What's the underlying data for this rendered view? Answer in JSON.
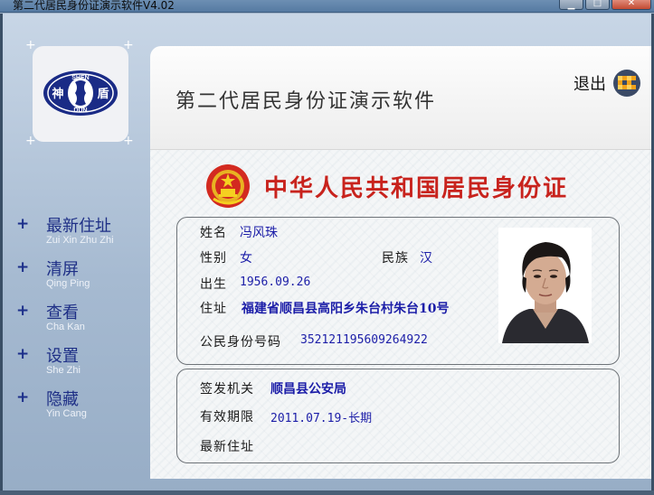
{
  "window": {
    "title": "第二代居民身份证演示软件V4.02",
    "minimize_glyph": "▁",
    "maximize_glyph": "□",
    "close_glyph": "✕"
  },
  "logo": {
    "icon": "shendun-logo-icon",
    "text_top": "SHEN",
    "text_bottom": "DUN",
    "text_left": "神",
    "text_right": "盾",
    "brand_color": "#1a2b86"
  },
  "menu": {
    "items": [
      {
        "label": "最新住址",
        "pinyin": "Zui Xin Zhu Zhi"
      },
      {
        "label": "清屏",
        "pinyin": "Qing Ping"
      },
      {
        "label": "查看",
        "pinyin": "Cha Kan"
      },
      {
        "label": "设置",
        "pinyin": "She Zhi"
      },
      {
        "label": "隐藏",
        "pinyin": "Yin Cang"
      }
    ],
    "plus_glyph": "+"
  },
  "header": {
    "title": "第二代居民身份证演示软件",
    "exit_label": "退出",
    "exit_icon": "exit-checker-icon"
  },
  "card": {
    "title": "中华人民共和国居民身份证",
    "emblem_icon": "national-emblem-icon",
    "title_color": "#c8231d",
    "name_label": "姓名",
    "name": "冯风珠",
    "sex_label": "性别",
    "sex": "女",
    "ethnicity_label": "民族",
    "ethnicity": "汉",
    "birth_label": "出生",
    "birth": "1956.09.26",
    "address_label": "住址",
    "address": "福建省顺昌县高阳乡朱台村朱台10号",
    "id_label": "公民身份号码",
    "id_number": "352121195609264922",
    "issuer_label": "签发机关",
    "issuer": "顺昌县公安局",
    "validity_label": "有效期限",
    "validity": "2011.07.19-长期",
    "latest_address_label": "最新住址",
    "latest_address": "",
    "photo_icon": "portrait-photo-icon",
    "value_color": "#1c1ea8"
  }
}
